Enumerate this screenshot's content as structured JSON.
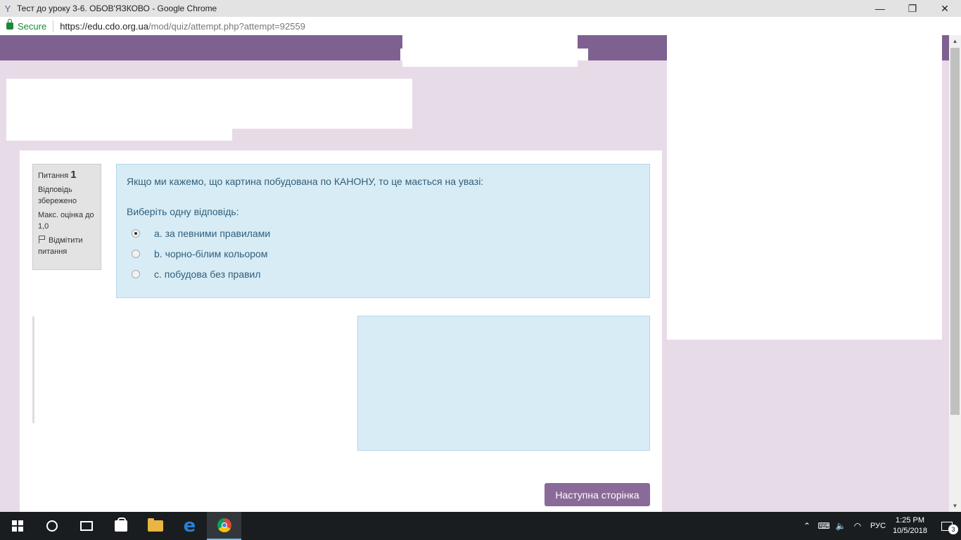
{
  "window": {
    "title": "Тест до уроку 3-6. ОБОВ'ЯЗКОВО - Google Chrome",
    "minimize": "—",
    "restore": "❐",
    "close": "✕"
  },
  "addressbar": {
    "secure_label": "Secure",
    "url_host": "https://edu.cdo.org.ua",
    "url_path": "/mod/quiz/attempt.php?attempt=92559"
  },
  "question_info": {
    "label": "Питання",
    "number": "1",
    "status": "Відповідь збережено",
    "max_grade": "Макс. оцінка до 1,0",
    "flag_label": "Відмітити питання"
  },
  "question": {
    "text": "Якщо ми кажемо, що картина побудована по КАНОНУ, то це мається на увазі:",
    "prompt": "Виберіть одну відповідь:",
    "options": [
      {
        "label": "a. за певними правилами",
        "checked": true
      },
      {
        "label": "b. чорно-білим кольором",
        "checked": false
      },
      {
        "label": "c. побудова без правил",
        "checked": false
      }
    ]
  },
  "next_button": "Наступна сторінка",
  "taskbar": {
    "lang": "РУС",
    "time": "1:25 PM",
    "date": "10/5/2018",
    "notifications": "3"
  },
  "colors": {
    "brand_purple": "#7f6191",
    "question_bg": "#d8ecf5",
    "page_bg": "#e8dbe8"
  }
}
